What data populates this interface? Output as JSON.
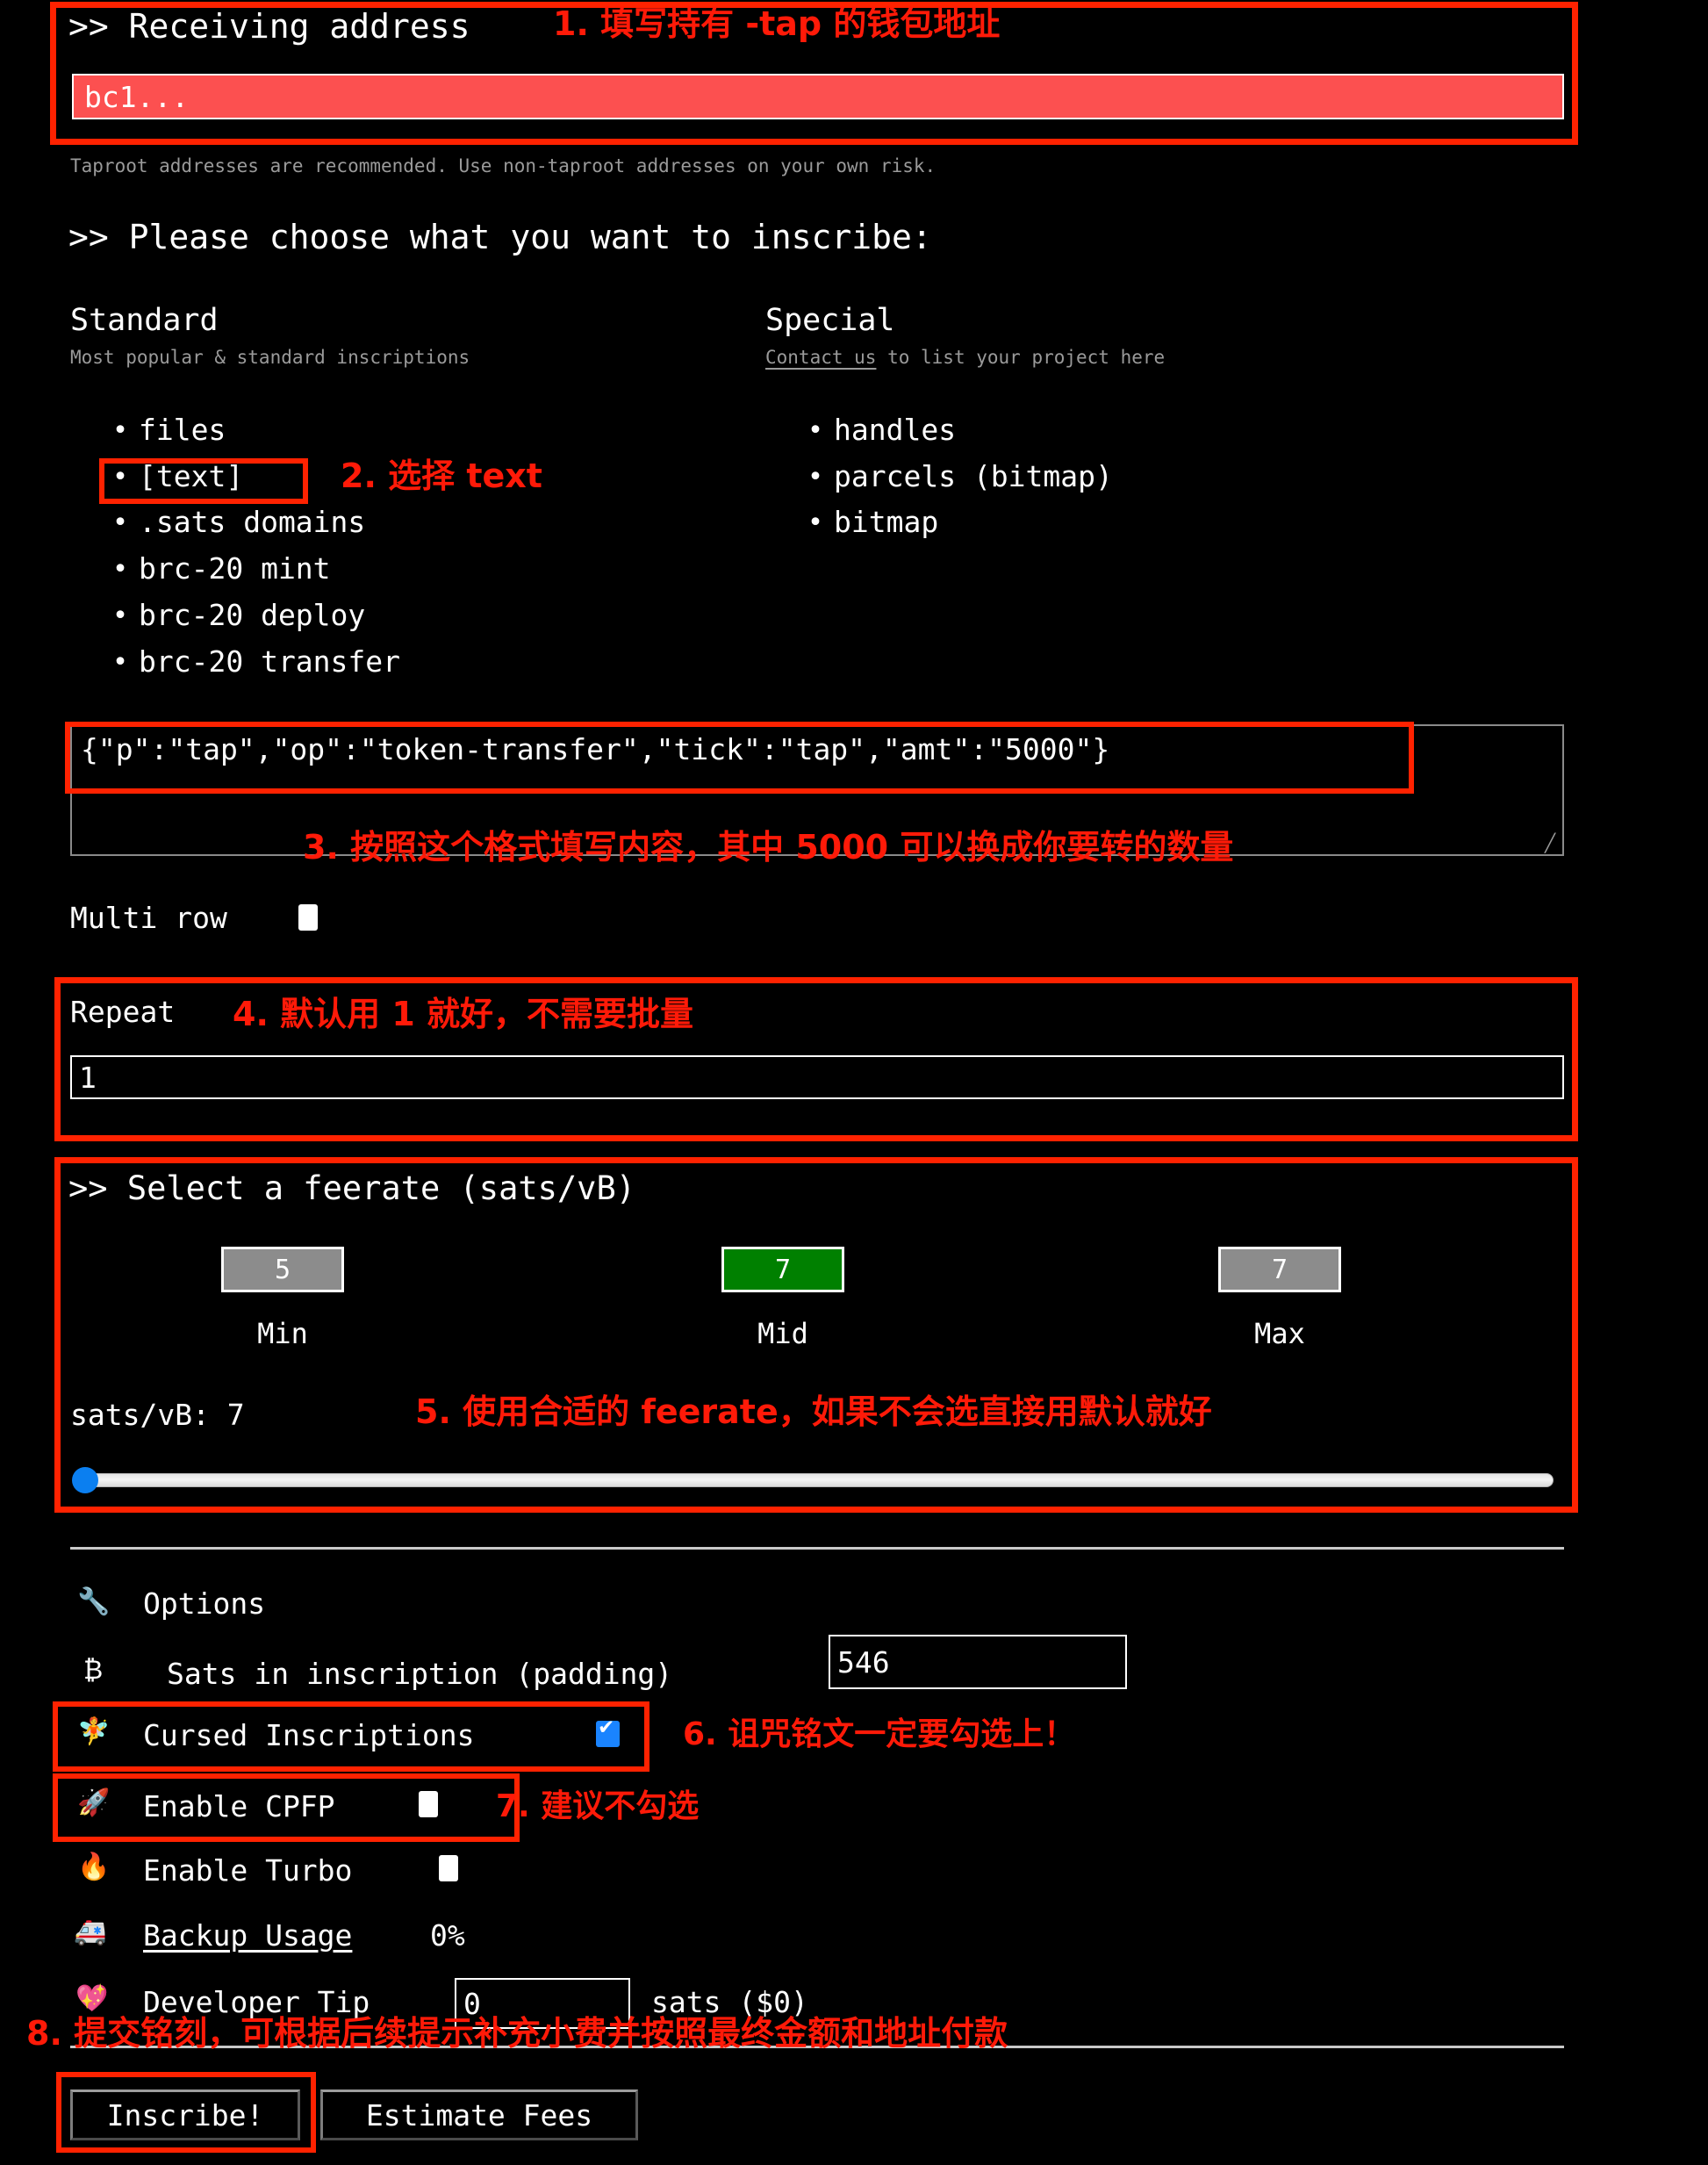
{
  "address_section": {
    "heading": ">> Receiving address",
    "annotation": "1. 填写持有 -tap 的钱包地址",
    "input_value": "bc1...",
    "hint": "Taproot addresses are recommended. Use non-taproot addresses on your own risk."
  },
  "choose_section": {
    "heading": ">> Please choose what you want to inscribe:",
    "standard": {
      "title": "Standard",
      "subtitle": "Most popular & standard inscriptions",
      "items": [
        "files",
        "[text]",
        ".sats domains",
        "brc-20 mint",
        "brc-20 deploy",
        "brc-20 transfer"
      ],
      "selected_index": 1,
      "annotation": "2. 选择 text"
    },
    "special": {
      "title": "Special",
      "subtitle_link": "Contact us",
      "subtitle_rest": " to list your project here",
      "items": [
        "handles",
        "parcels (bitmap)",
        "bitmap"
      ]
    }
  },
  "content_section": {
    "textarea_value": "{\"p\":\"tap\",\"op\":\"token-transfer\",\"tick\":\"tap\",\"amt\":\"5000\"}",
    "annotation": "3. 按照这个格式填写内容，其中 5000 可以换成你要转的数量",
    "multirow_label": "Multi row",
    "multirow_checked": false
  },
  "repeat_section": {
    "label": "Repeat",
    "annotation": "4. 默认用 1 就好，不需要批量",
    "value": "1"
  },
  "feerate_section": {
    "heading": ">> Select a feerate (sats/vB)",
    "buttons": [
      {
        "value": "5",
        "label": "Min",
        "state": "gray"
      },
      {
        "value": "7",
        "label": "Mid",
        "state": "green"
      },
      {
        "value": "7",
        "label": "Max",
        "state": "gray"
      }
    ],
    "current_label": "sats/vB: 7",
    "annotation": "5. 使用合适的 feerate，如果不会选直接用默认就好",
    "slider_value": 0,
    "colors": {
      "selected": "#008000",
      "unselected": "#8c8c8c",
      "thumb": "#0b7ff0"
    }
  },
  "options_section": {
    "title": "Options",
    "title_icon": "wrench-icon",
    "padding_row": {
      "icon": "bitcoin-icon",
      "label": "Sats in inscription (padding)",
      "value": "546"
    },
    "cursed_row": {
      "icon": "fairy-icon",
      "label": "Cursed Inscriptions",
      "checked": true,
      "annotation": "6. 诅咒铭文一定要勾选上！"
    },
    "cpfp_row": {
      "icon": "rocket-icon",
      "label": "Enable CPFP",
      "checked": false,
      "annotation": "7. 建议不勾选"
    },
    "turbo_row": {
      "icon": "fire-icon",
      "label": "Enable Turbo",
      "checked": false
    },
    "backup_row": {
      "icon": "ambulance-icon",
      "label": "Backup Usage",
      "value": "0%"
    },
    "tip_row": {
      "icon": "sparkling-heart-icon",
      "label": "Developer Tip",
      "value": "0",
      "suffix": "sats ($0)"
    }
  },
  "footer": {
    "annotation": "8. 提交铭刻，可根据后续提示补充小费并按照最终金额和地址付款",
    "inscribe_label": "Inscribe!",
    "estimate_label": "Estimate Fees"
  }
}
